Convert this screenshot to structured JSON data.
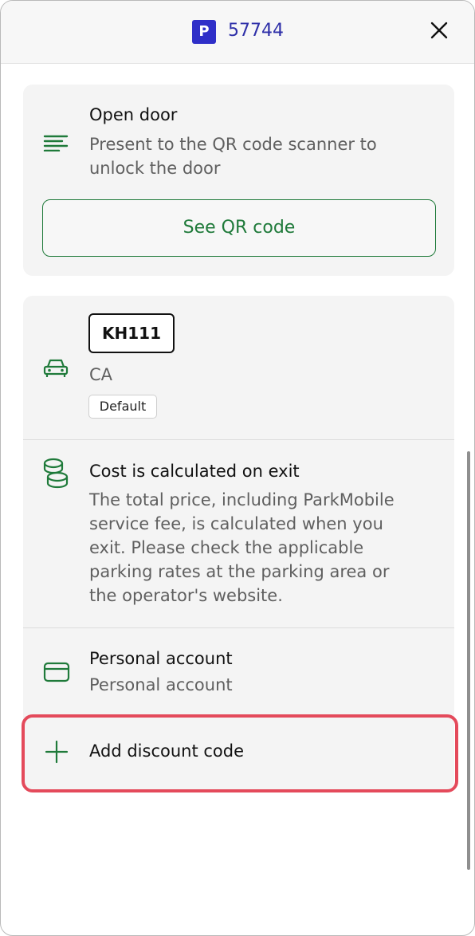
{
  "header": {
    "badge": "P",
    "zone_number": "57744",
    "close_icon": "close-icon"
  },
  "access": {
    "title": "Open door",
    "description_line1": "Present to the QR code scanner to",
    "description_line2": "unlock the door",
    "button_label": "See QR code",
    "icon": "text-lines-icon"
  },
  "vehicle": {
    "plate": "KH111",
    "state": "CA",
    "badge": "Default",
    "icon": "car-icon"
  },
  "cost": {
    "title": "Cost is calculated on exit",
    "lines": [
      "The total price, including ParkMobile",
      "service fee, is calculated when you",
      "exit. Please check the applicable",
      "parking rates at the parking area or",
      "the operator's website."
    ],
    "icon": "coins-icon"
  },
  "payment": {
    "title": "Personal account",
    "subtitle": "Personal account",
    "icon": "card-icon"
  },
  "discount": {
    "label": "Add discount code",
    "icon": "plus-icon"
  },
  "colors": {
    "accent_green": "#1f7a3a",
    "badge_blue": "#2f2fc8",
    "highlight_red": "#e44a5b"
  }
}
